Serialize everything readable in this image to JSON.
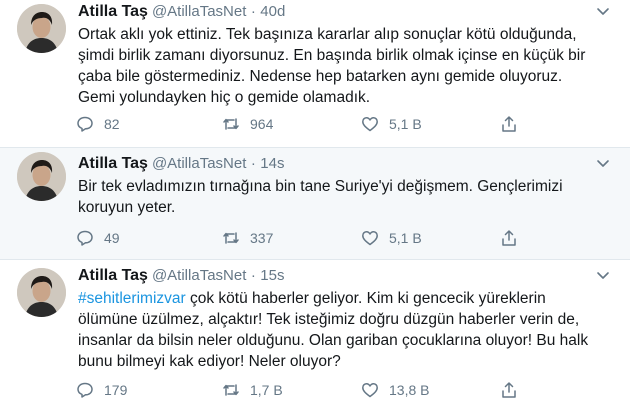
{
  "tweets": [
    {
      "name": "Atilla Taş",
      "handle": "@AtillaTasNet",
      "separator": "·",
      "time": "40d",
      "text": "Ortak aklı yok ettiniz. Tek başınıza kararlar alıp sonuçlar kötü olduğunda, şimdi birlik zamanı diyorsunuz. En başında birlik olmak içinse en küçük bir çaba bile göstermediniz. Nedense hep batarken aynı gemide oluyoruz. Gemi yolundayken hiç o gemide olamadık.",
      "replies": "82",
      "retweets": "964",
      "likes": "5,1 B"
    },
    {
      "name": "Atilla Taş",
      "handle": "@AtillaTasNet",
      "separator": "·",
      "time": "14s",
      "text": "Bir tek evladımızın tırnağına bin tane Suriye'yi değişmem. Gençlerimizi koruyun yeter.",
      "replies": "49",
      "retweets": "337",
      "likes": "5,1 B"
    },
    {
      "name": "Atilla Taş",
      "handle": "@AtillaTasNet",
      "separator": "·",
      "time": "15s",
      "hashtag": "#sehitlerimizvar",
      "text": " çok kötü haberler geliyor. Kim ki gencecik yüreklerin ölümüne üzülmez, alçaktır! Tek isteğimiz doğru düzgün haberler verin de, insanlar da bilsin neler olduğunu. Olan gariban çocuklarına oluyor! Bu halk bunu bilmeyi kak ediyor! Neler oluyor?",
      "replies": "179",
      "retweets": "1,7 B",
      "likes": "13,8 B"
    }
  ],
  "colors": {
    "text": "#14171a",
    "muted": "#657786",
    "link": "#1b95e0",
    "divider": "#e1e8ed"
  },
  "icons": [
    "chevron-down-icon",
    "reply-icon",
    "retweet-icon",
    "like-icon",
    "share-icon"
  ]
}
